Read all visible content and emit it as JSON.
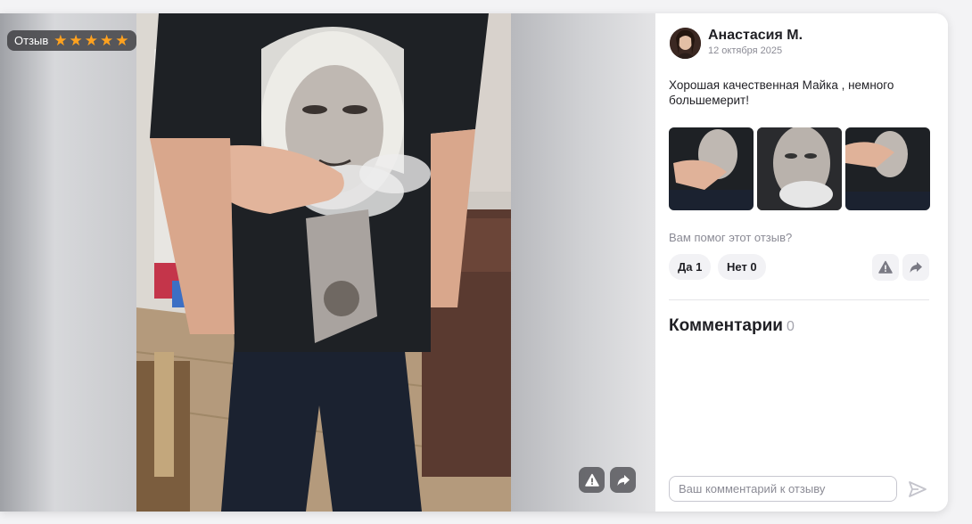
{
  "badge": {
    "label": "Отзыв",
    "rating": 5,
    "max_rating": 5
  },
  "review": {
    "author": "Анастасия М.",
    "date": "12 октября 2025",
    "text": "Хорошая качественная Майка , немного большемерит!"
  },
  "helpful": {
    "question": "Вам помог этот отзыв?",
    "yes_label": "Да 1",
    "no_label": "Нет 0"
  },
  "comments": {
    "title": "Комментарии",
    "count": "0",
    "placeholder": "Ваш комментарий к отзыву"
  },
  "icons": {
    "report": "warning-triangle-icon",
    "share": "share-arrow-icon",
    "send": "send-icon",
    "star": "star-icon"
  },
  "colors": {
    "star": "#ffa21f",
    "text": "#1f1f24",
    "muted": "#8b8b95",
    "button_bg": "#f2f2f5"
  }
}
